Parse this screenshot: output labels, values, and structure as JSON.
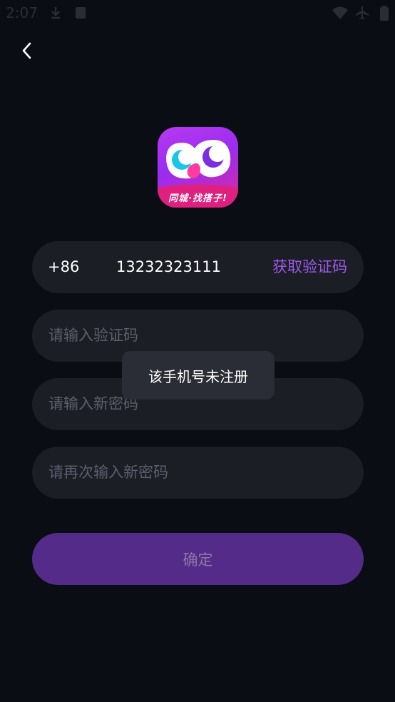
{
  "status_bar": {
    "time": "2:07"
  },
  "header": {
    "back_icon": "chevron-left-icon"
  },
  "logo": {
    "tagline": "同城·找搭子!"
  },
  "form": {
    "phone": {
      "country_code": "+86",
      "value": "13232323111",
      "get_code_label": "获取验证码"
    },
    "code_placeholder": "请输入验证码",
    "new_password_placeholder": "请输入新密码",
    "confirm_password_placeholder": "请再次输入新密码",
    "confirm_label": "确定"
  },
  "toast": {
    "message": "该手机号未注册"
  },
  "colors": {
    "background": "#0b0d14",
    "field": "#1c1e26",
    "accent": "#9b59e6",
    "button": "#552b8a"
  }
}
